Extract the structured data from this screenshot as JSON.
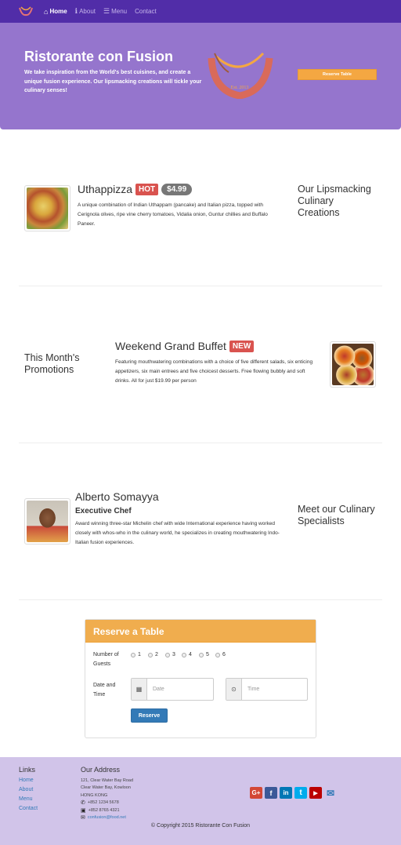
{
  "nav": {
    "items": [
      {
        "label": "Home",
        "icon": "home-icon"
      },
      {
        "label": "About",
        "icon": "info-icon"
      },
      {
        "label": "Menu",
        "icon": "list-icon"
      },
      {
        "label": "Contact",
        "icon": ""
      }
    ]
  },
  "jumbotron": {
    "title": "Ristorante con Fusion",
    "text": "We take inspiration from the World's best cuisines, and create a unique fusion experience. Our lipsmacking creations will tickle your culinary senses!",
    "logo_text": "Ristorante con Fusion",
    "logo_est": "Est. 2013",
    "reserve_label": "Reserve Table"
  },
  "dish": {
    "name": "Uthappizza",
    "label": "HOT",
    "price": "$4.99",
    "description": "A unique combination of Indian Uthappam (pancake) and Italian pizza, topped with Cerignola olives, ripe vine cherry tomatoes, Vidalia onion, Guntur chillies and Buffalo Paneer.",
    "side_heading": "Our Lipsmacking Culinary Creations"
  },
  "promotion": {
    "side_heading": "This Month's Promotions",
    "name": "Weekend Grand Buffet",
    "label": "NEW",
    "description": "Featuring mouthwatering combinations with a choice of five different salads, six enticing appetizers, six main entrees and five choicest desserts. Free flowing bubbly and soft drinks. All for just $19.99 per person"
  },
  "leader": {
    "name": "Alberto Somayya",
    "designation": "Executive Chef",
    "description": "Award winning three-star Michelin chef with wide International experience having worked closely with whos-who in the culinary world, he specializes in creating mouthwatering Indo-Italian fusion experiences.",
    "side_heading": "Meet our Culinary Specialists"
  },
  "reserve": {
    "heading": "Reserve a Table",
    "guests_label": "Number of Guests",
    "guest_options": [
      "1",
      "2",
      "3",
      "4",
      "5",
      "6"
    ],
    "datetime_label": "Date and Time",
    "date_placeholder": "Date",
    "time_placeholder": "Time",
    "submit_label": "Reserve"
  },
  "footer": {
    "links_heading": "Links",
    "links": [
      "Home",
      "About",
      "Menu",
      "Contact"
    ],
    "address_heading": "Our Address",
    "address_lines": [
      "121, Clear Water Bay Road",
      "Clear Water Bay, Kowloon",
      "HONG KONG"
    ],
    "phone": "+852 1234 5678",
    "fax": "+852 8765 4321",
    "email": "confusion@food.net",
    "social": [
      "google-plus-icon",
      "facebook-icon",
      "linkedin-icon",
      "twitter-icon",
      "youtube-icon",
      "envelope-icon"
    ],
    "copyright": "© Copyright 2015 Ristorante Con Fusion"
  },
  "colors": {
    "navbar": "#512da8",
    "jumbotron": "#9575cd",
    "footer": "#d1c4e9",
    "accent": "#f0ad4e",
    "primary": "#337ab7"
  }
}
